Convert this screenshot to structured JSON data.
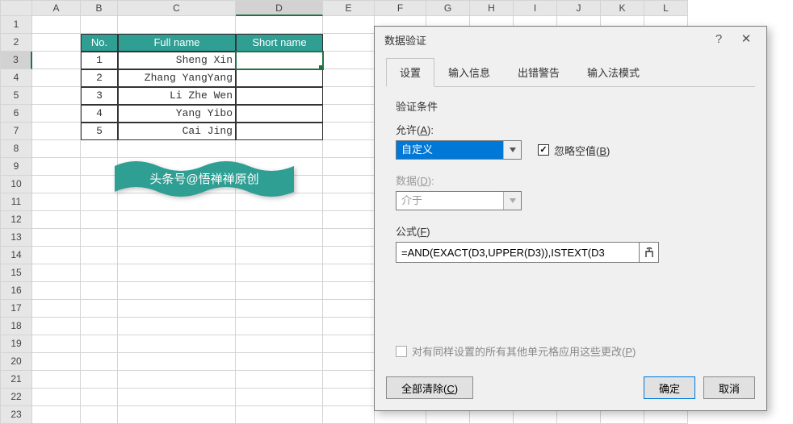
{
  "columns": [
    "A",
    "B",
    "C",
    "D",
    "E",
    "F",
    "G",
    "H",
    "I",
    "J",
    "K",
    "L"
  ],
  "rowCount": 23,
  "selected": {
    "col": "D",
    "row": 3
  },
  "table": {
    "headers": {
      "no": "No.",
      "full": "Full name",
      "short": "Short name"
    },
    "rows": [
      {
        "no": "1",
        "full": "Sheng Xin",
        "short": ""
      },
      {
        "no": "2",
        "full": "Zhang YangYang",
        "short": ""
      },
      {
        "no": "3",
        "full": "Li Zhe Wen",
        "short": ""
      },
      {
        "no": "4",
        "full": "Yang Yibo",
        "short": ""
      },
      {
        "no": "5",
        "full": "Cai Jing",
        "short": ""
      }
    ]
  },
  "banner": {
    "text": "头条号@悟禅禅原创"
  },
  "dialog": {
    "title": "数据验证",
    "help_icon": "?",
    "close_icon": "✕",
    "tabs": {
      "settings": "设置",
      "input_msg": "输入信息",
      "error_alert": "出错警告",
      "ime_mode": "输入法模式"
    },
    "section": "验证条件",
    "allow_label": "允许(A):",
    "allow_value": "自定义",
    "ignore_blank_label": "忽略空值(B)",
    "ignore_blank_checked": true,
    "data_label": "数据(D):",
    "data_value": "介于",
    "formula_label": "公式(F)",
    "formula_value": "=AND(EXACT(D3,UPPER(D3)),ISTEXT(D3",
    "apply_label": "对有同样设置的所有其他单元格应用这些更改(P)",
    "clear_all": "全部清除(C)",
    "ok": "确定",
    "cancel": "取消"
  }
}
